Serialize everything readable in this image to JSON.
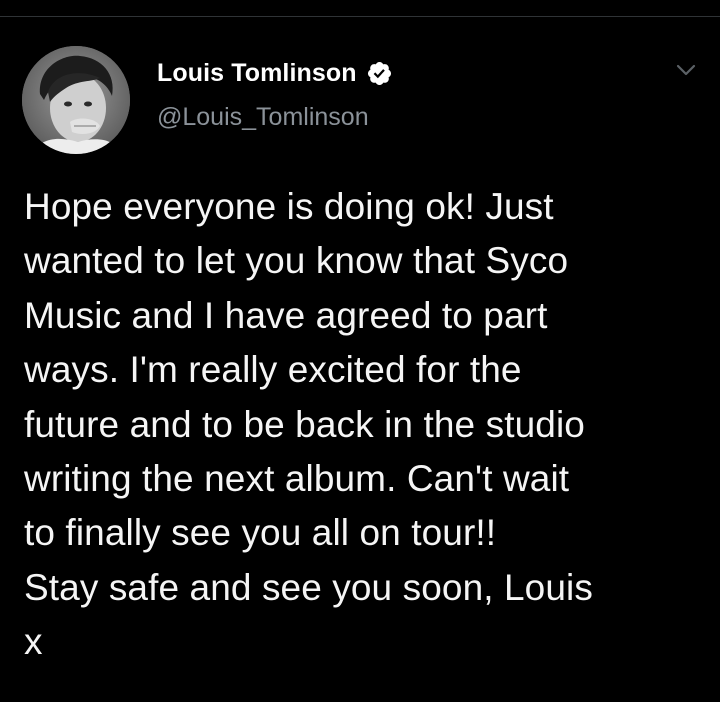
{
  "tweet": {
    "author": {
      "display_name": "Louis Tomlinson",
      "handle": "@Louis_Tomlinson",
      "verified": true,
      "avatar": "profile-photo"
    },
    "menu_icon": "chevron-down-icon",
    "lines": [
      "Hope everyone is doing ok! Just",
      "wanted to let you know that Syco",
      "Music and I have agreed to part",
      "ways. I'm really excited for the",
      "future and to be back in the studio",
      "writing the next album. Can't wait",
      "to finally see you all on tour!!",
      "Stay safe and see you soon, Louis",
      "x"
    ]
  },
  "colors": {
    "background": "#000000",
    "text": "#ffffff",
    "muted": "#8b9299",
    "divider": "#2f3336"
  }
}
